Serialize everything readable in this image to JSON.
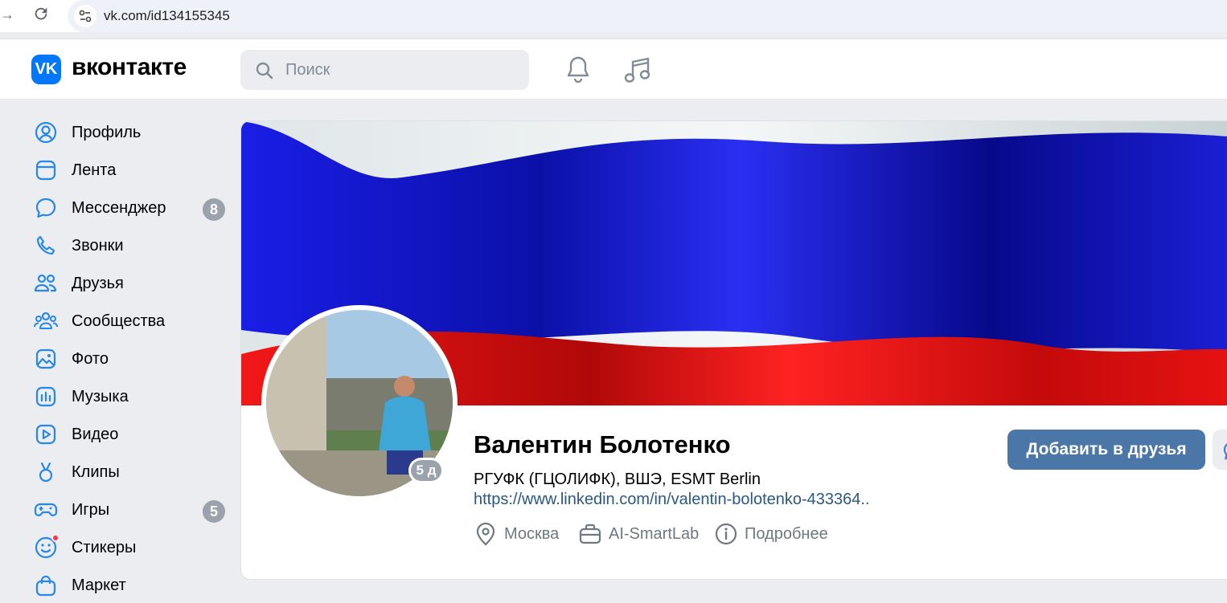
{
  "browser": {
    "url": "vk.com/id134155345"
  },
  "header": {
    "logo_text": "вконтакте",
    "search_placeholder": "Поиск"
  },
  "sidebar": {
    "items": [
      {
        "label": "Профиль",
        "icon": "profile-icon"
      },
      {
        "label": "Лента",
        "icon": "feed-icon"
      },
      {
        "label": "Мессенджер",
        "icon": "messenger-icon",
        "count": "8"
      },
      {
        "label": "Звонки",
        "icon": "phone-icon"
      },
      {
        "label": "Друзья",
        "icon": "friends-icon"
      },
      {
        "label": "Сообщества",
        "icon": "communities-icon"
      },
      {
        "label": "Фото",
        "icon": "photo-icon"
      },
      {
        "label": "Музыка",
        "icon": "music-icon"
      },
      {
        "label": "Видео",
        "icon": "video-icon"
      },
      {
        "label": "Клипы",
        "icon": "clips-icon"
      },
      {
        "label": "Игры",
        "icon": "games-icon",
        "count": "5"
      },
      {
        "label": "Стикеры",
        "icon": "stickers-icon"
      },
      {
        "label": "Маркет",
        "icon": "market-icon"
      }
    ]
  },
  "profile": {
    "name": "Валентин Болотенко",
    "education": "РГУФК (ГЦОЛИФК), ВШЭ, ESMT Berlin",
    "link": "https://www.linkedin.com/in/valentin-bolotenko-433364..",
    "city": "Москва",
    "company": "AI-SmartLab",
    "more_label": "Подробнее",
    "online_badge": "5 д",
    "add_friend_label": "Добавить в друзья"
  },
  "colors": {
    "accent": "#4a76a8",
    "vk_blue": "#0077ff",
    "link": "#2a5885",
    "badge": "#99a2ad"
  }
}
